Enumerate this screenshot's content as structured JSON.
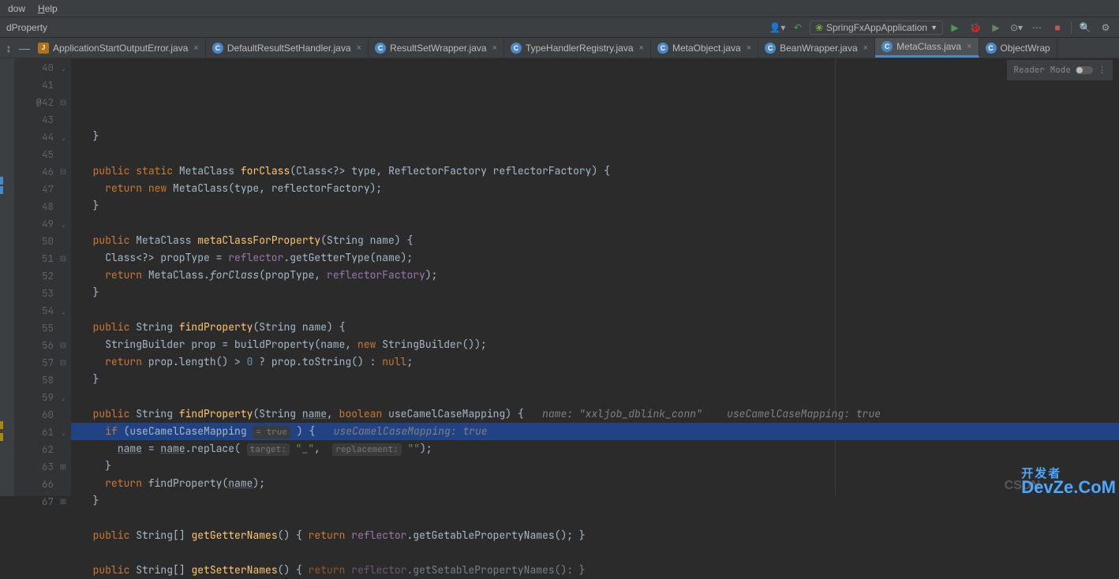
{
  "menu": {
    "window": "dow",
    "window_underline": "W",
    "help": "Help",
    "help_underline": "H"
  },
  "breadcrumb": "dProperty",
  "run_config": "SpringFxAppApplication",
  "reader_mode_label": "Reader Mode",
  "tabs": [
    {
      "icon": "java",
      "label": "ApplicationStartOutputError.java"
    },
    {
      "icon": "class",
      "label": "DefaultResultSetHandler.java"
    },
    {
      "icon": "class",
      "label": "ResultSetWrapper.java"
    },
    {
      "icon": "class",
      "label": "TypeHandlerRegistry.java"
    },
    {
      "icon": "class",
      "label": "MetaObject.java"
    },
    {
      "icon": "class",
      "label": "BeanWrapper.java"
    },
    {
      "icon": "class",
      "label": "MetaClass.java",
      "active": true
    },
    {
      "icon": "class",
      "label": "ObjectWrap"
    }
  ],
  "gutter_start": 40,
  "lines": [
    {
      "n": 40,
      "fold": "close",
      "html": "  }"
    },
    {
      "n": 41,
      "html": ""
    },
    {
      "n": 42,
      "override": "@",
      "fold": "open",
      "html": "  <span class='kw'>public</span> <span class='kw'>static</span> MetaClass <span class='method-decl'>forClass</span>(Class&lt;?&gt; type, ReflectorFactory reflectorFactory) {"
    },
    {
      "n": 43,
      "html": "    <span class='kw'>return</span> <span class='kw'>new</span> MetaClass(type, reflectorFactory);"
    },
    {
      "n": 44,
      "fold": "close",
      "html": "  }"
    },
    {
      "n": 45,
      "html": ""
    },
    {
      "n": 46,
      "fold": "open",
      "html": "  <span class='kw'>public</span> MetaClass <span class='method-decl'>metaClassForProperty</span>(String name) {"
    },
    {
      "n": 47,
      "html": "    Class&lt;?&gt; propType = <span class='field'>reflector</span>.getGetterType(name);"
    },
    {
      "n": 48,
      "html": "    <span class='kw'>return</span> MetaClass.<span class='static-call'>forClass</span>(propType, <span class='field'>reflectorFactory</span>);"
    },
    {
      "n": 49,
      "fold": "close",
      "html": "  }"
    },
    {
      "n": 50,
      "html": ""
    },
    {
      "n": 51,
      "fold": "open",
      "html": "  <span class='kw'>public</span> String <span class='method-decl'>findProperty</span>(String name) {"
    },
    {
      "n": 52,
      "html": "    StringBuilder prop = buildProperty(name, <span class='kw'>new</span> StringBuilder());"
    },
    {
      "n": 53,
      "html": "    <span class='kw'>return</span> prop.length() &gt; <span class='num'>0</span> ? prop.toString() : <span class='kw'>null</span>;"
    },
    {
      "n": 54,
      "fold": "close",
      "html": "  }"
    },
    {
      "n": 55,
      "html": ""
    },
    {
      "n": 56,
      "fold": "open",
      "html": "  <span class='kw'>public</span> String <span class='method-decl'>findProperty</span>(String <span class='underlined'>name</span>, <span class='kw'>boolean</span> useCamelCaseMapping) {   <span class='comment'>name: \"xxljob_dblink_conn\"    useCamelCaseMapping: true</span>"
    },
    {
      "n": 57,
      "highlighted": true,
      "fold": "open",
      "html": "    <span class='kw'>if</span> (useCamelCaseMapping <span class='param-hint'>= true</span> ) {   <span class='comment'>useCamelCaseMapping: true</span>"
    },
    {
      "n": 58,
      "html": "      <span class='underlined'>name</span> = <span class='underlined'>name</span>.replace( <span class='param-hint'>target:</span> <span class='str'>\"_\"</span>,  <span class='param-hint'>replacement:</span> <span class='str'>\"\"</span>);"
    },
    {
      "n": 59,
      "fold": "close",
      "html": "    }"
    },
    {
      "n": 60,
      "html": "    <span class='kw'>return</span> findProperty(<span class='underlined'>name</span>);"
    },
    {
      "n": 61,
      "fold": "close",
      "html": "  }"
    },
    {
      "n": 62,
      "html": ""
    },
    {
      "n": 63,
      "fold": "both",
      "html": "  <span class='kw'>public</span> String[] <span class='method-decl'>getGetterNames</span>() { <span class='kw'>return</span> <span class='field'>reflector</span>.getGetablePropertyNames(); }"
    },
    {
      "n": 66,
      "html": ""
    },
    {
      "n": 67,
      "fold": "both",
      "html": "  <span class='kw'>public</span> String[] <span class='method-decl'>getSetterNames</span>() { <span class='kw' style='opacity:.6'>return</span> <span class='field' style='opacity:.6'>reflector</span><span style='opacity:.6'>.getSetablePropertyNames(): }</span>"
    }
  ],
  "watermark_csdn": "CSDN",
  "watermark_dev_cn": "开发者",
  "watermark_dev_en": "DevZe.CoM"
}
